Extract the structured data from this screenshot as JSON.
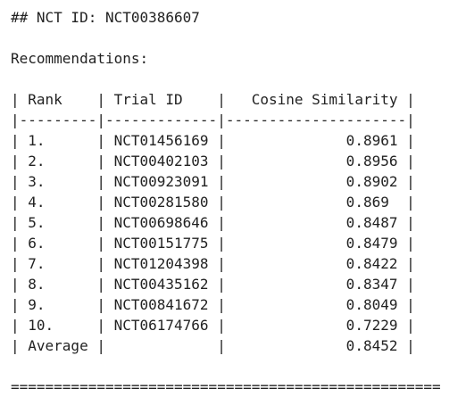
{
  "heading": "## NCT ID: NCT00386607",
  "recommendations_label": "Recommendations:",
  "table": {
    "header": "| Rank    | Trial ID    |   Cosine Similarity |",
    "separator": "|---------|-------------|---------------------|",
    "rows": [
      "| 1.      | NCT01456169 |              0.8961 |",
      "| 2.      | NCT00402103 |              0.8956 |",
      "| 3.      | NCT00923091 |              0.8902 |",
      "| 4.      | NCT00281580 |              0.869  |",
      "| 5.      | NCT00698646 |              0.8487 |",
      "| 6.      | NCT00151775 |              0.8479 |",
      "| 7.      | NCT01204398 |              0.8422 |",
      "| 8.      | NCT00435162 |              0.8347 |",
      "| 9.      | NCT00841672 |              0.8049 |",
      "| 10.     | NCT06174766 |              0.7229 |",
      "| Average |             |              0.8452 |"
    ]
  },
  "footer_rule": "=================================================="
}
